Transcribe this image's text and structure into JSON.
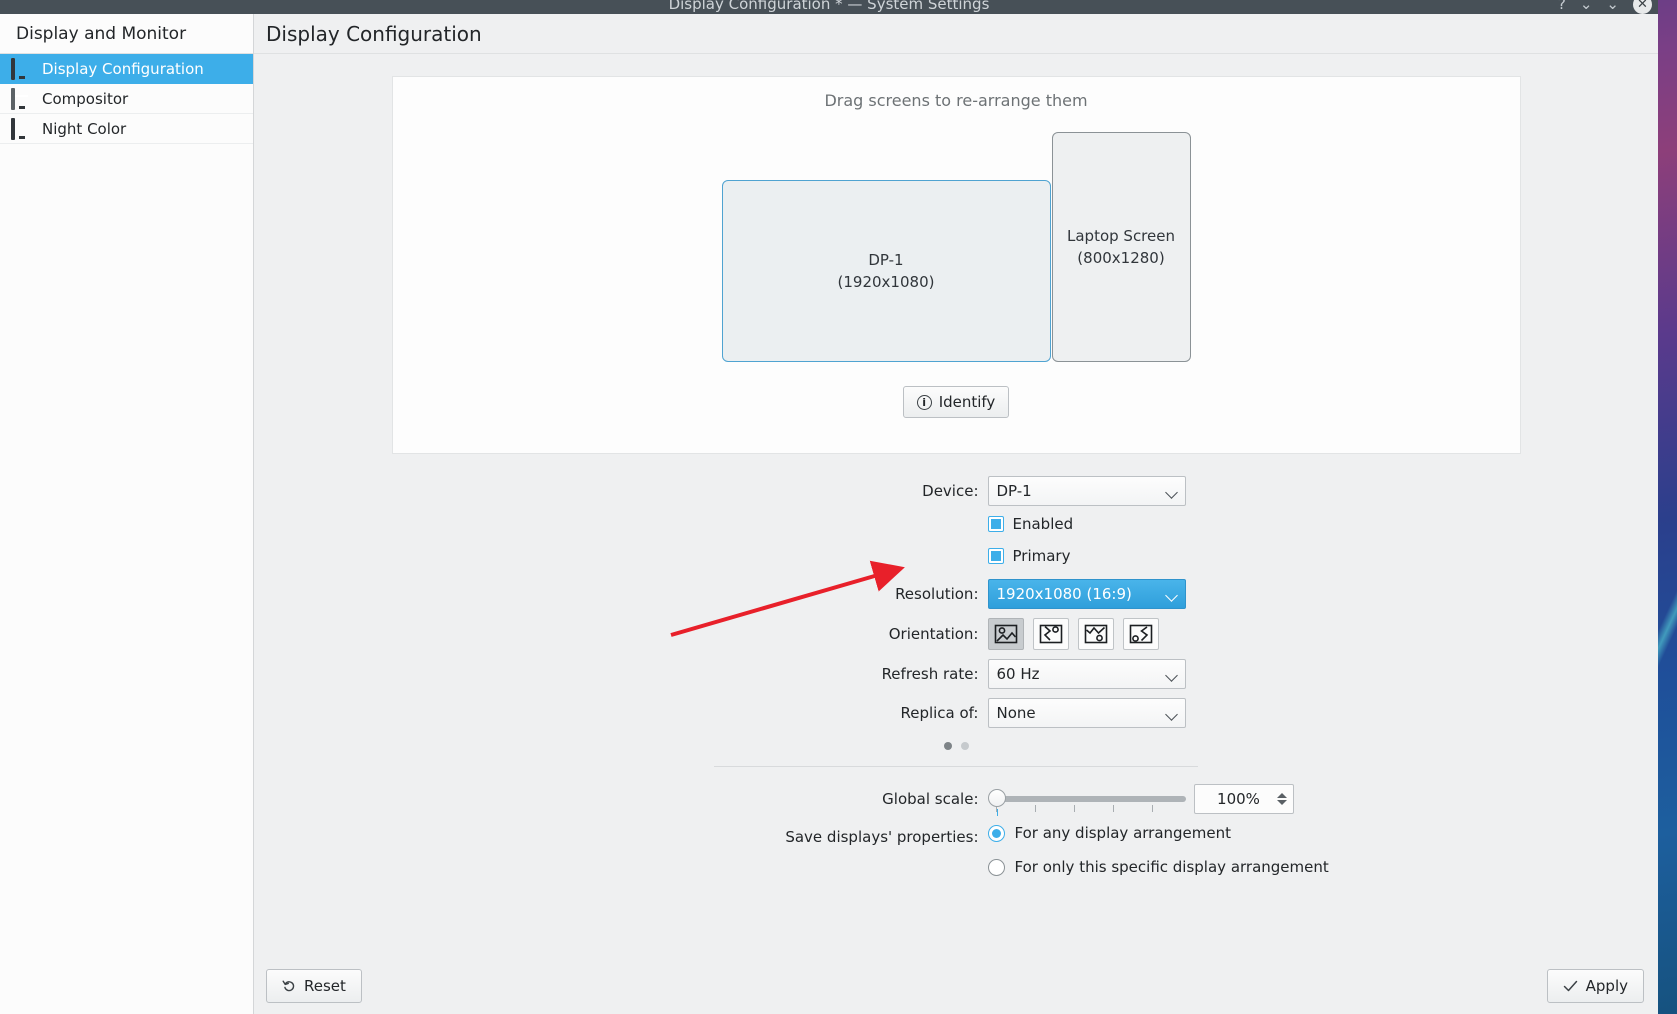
{
  "titlebar": {
    "title": "Display Configuration * — System Settings",
    "help_icon": "help-icon",
    "minimize_icon": "minimize-icon",
    "maximize_icon": "maximize-icon",
    "close_icon": "close-icon"
  },
  "sidebar": {
    "header": "Display and Monitor",
    "items": [
      {
        "label": "Display Configuration",
        "icon": "monitor-icon",
        "selected": true
      },
      {
        "label": "Compositor",
        "icon": "compositor-icon",
        "selected": false
      },
      {
        "label": "Night Color",
        "icon": "monitor-icon",
        "selected": false
      }
    ]
  },
  "main": {
    "header": "Display Configuration",
    "arrangement": {
      "hint": "Drag screens to re-arrange them",
      "screens": [
        {
          "name": "DP-1",
          "resolution": "(1920x1080)",
          "selected": true
        },
        {
          "name": "Laptop Screen",
          "resolution": "(800x1280)",
          "selected": false
        }
      ],
      "identify_label": "Identify",
      "identify_icon": "info-icon"
    },
    "form": {
      "device_label": "Device:",
      "device_value": "DP-1",
      "enabled_label": "Enabled",
      "enabled_checked": true,
      "primary_label": "Primary",
      "primary_checked": true,
      "resolution_label": "Resolution:",
      "resolution_value": "1920x1080 (16:9)",
      "resolution_highlighted": true,
      "orientation_label": "Orientation:",
      "orientation_options": [
        {
          "name": "orientation-0deg",
          "active": true
        },
        {
          "name": "orientation-90deg",
          "active": false
        },
        {
          "name": "orientation-180deg",
          "active": false
        },
        {
          "name": "orientation-270deg",
          "active": false
        }
      ],
      "refresh_label": "Refresh rate:",
      "refresh_value": "60 Hz",
      "replica_label": "Replica of:",
      "replica_value": "None",
      "page_dots": [
        true,
        false
      ]
    },
    "global": {
      "scale_label": "Global scale:",
      "scale_value": "100%",
      "scale_percent": 0,
      "save_label": "Save displays' properties:",
      "save_options": [
        {
          "label": "For any display arrangement",
          "selected": true
        },
        {
          "label": "For only this specific display arrangement",
          "selected": false
        }
      ]
    }
  },
  "footer": {
    "reset_label": "Reset",
    "reset_icon": "undo-icon",
    "apply_label": "Apply",
    "apply_icon": "check-icon"
  },
  "annotation": {
    "arrow_color": "#e8202a",
    "points_to": "resolution-combo"
  },
  "colors": {
    "accent": "#3daee9",
    "window_bg": "#eff0f1",
    "text": "#232629",
    "titlebar": "#475057"
  }
}
